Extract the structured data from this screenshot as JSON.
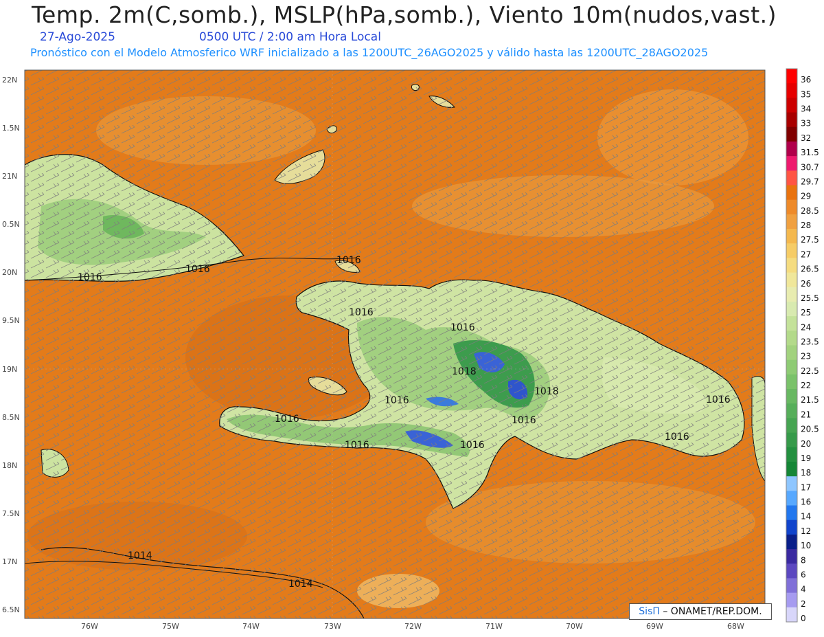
{
  "header": {
    "title": "Temp. 2m(C,somb.), MSLP(hPa,somb.), Viento 10m(nudos,vast.)",
    "date": "27-Ago-2025",
    "time": "0500 UTC / 2:00 am Hora Local",
    "model_line": "Pronóstico con el Modelo Atmosferico WRF inicializado a las 1200UTC_26AGO2025 y válido hasta las  1200UTC_28AGO2025"
  },
  "axes": {
    "y_labels": [
      "22N",
      "1.5N",
      "21N",
      "0.5N",
      "20N",
      "9.5N",
      "19N",
      "8.5N",
      "18N",
      "7.5N",
      "17N",
      "6.5N"
    ],
    "x_labels": [
      "76W",
      "75W",
      "74W",
      "73W",
      "72W",
      "71W",
      "70W",
      "69W",
      "68W"
    ]
  },
  "isobars": [
    "1016",
    "1016",
    "1016",
    "1016",
    "1016",
    "1018",
    "1016",
    "1018",
    "1016",
    "1016",
    "1016",
    "1016",
    "1016",
    "1016",
    "1014",
    "1014"
  ],
  "colorbar": {
    "labels": [
      "36",
      "35",
      "34",
      "33",
      "32",
      "31.5",
      "30.7",
      "29.7",
      "29",
      "28.5",
      "28",
      "27.5",
      "27",
      "26.5",
      "26",
      "25.5",
      "25",
      "24",
      "23.5",
      "23",
      "22.5",
      "22",
      "21.5",
      "21",
      "20.5",
      "20",
      "19",
      "18",
      "17",
      "16",
      "14",
      "12",
      "10",
      "8",
      "6",
      "4",
      "2",
      "0"
    ],
    "colors": [
      "#ff0000",
      "#e60000",
      "#cc0000",
      "#a80000",
      "#800000",
      "#b0004a",
      "#ee1a6e",
      "#ff5544",
      "#e9730f",
      "#ee8a2a",
      "#f0a040",
      "#f4b84e",
      "#f6cc66",
      "#f5dc80",
      "#f0e79a",
      "#e8ecb0",
      "#d8eab0",
      "#c4e29a",
      "#b3da8a",
      "#a2d27e",
      "#8ecb74",
      "#7ac26a",
      "#68b862",
      "#56ae5a",
      "#46a452",
      "#369a4a",
      "#249040",
      "#158636",
      "#8ec6ff",
      "#57a8ff",
      "#2277ee",
      "#1144cc",
      "#0a1f8a",
      "#3a2aa0",
      "#5c48c0",
      "#8070d8",
      "#a69bf0",
      "#d8d6fa"
    ]
  },
  "credit": {
    "brand": "SisΠ",
    "org": " – ONAMET/REP.DOM."
  }
}
